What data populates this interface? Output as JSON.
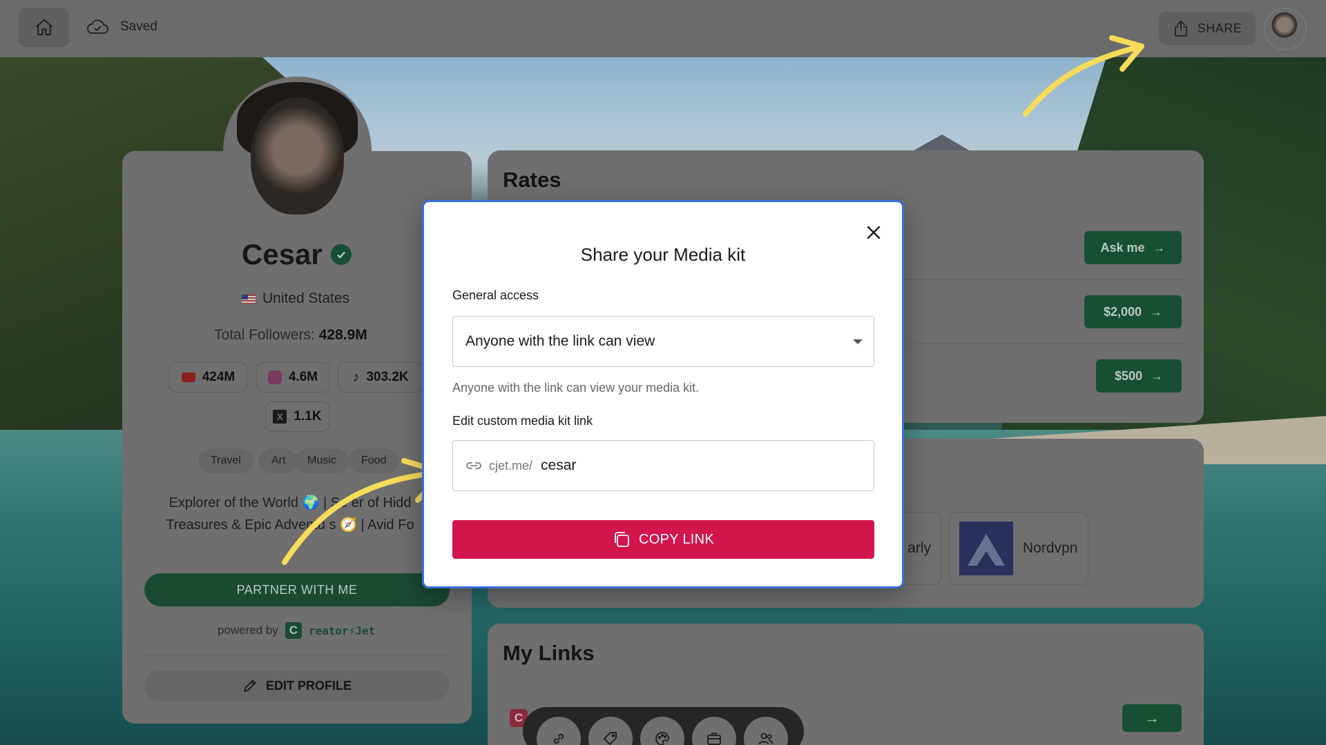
{
  "topbar": {
    "saved_label": "Saved",
    "share_label": "SHARE"
  },
  "profile": {
    "name": "Cesar",
    "country": "United States",
    "followers_label": "Total Followers:",
    "followers_value": "428.9M",
    "socials": [
      {
        "platform": "youtube",
        "count": "424M"
      },
      {
        "platform": "instagram",
        "count": "4.6M"
      },
      {
        "platform": "tiktok",
        "count": "303.2K"
      },
      {
        "platform": "x",
        "count": "1.1K"
      }
    ],
    "tags": [
      "Travel",
      "Art",
      "Music",
      "Food"
    ],
    "bio_line1": "Explorer of the World 🌍 | Se  er of Hidd",
    "bio_line2": "Treasures & Epic Adventu   s 🧭 | Avid Fo",
    "partner_label": "PARTNER WITH ME",
    "powered_by": "powered by",
    "brand_mark": "C",
    "brand_word": "reator⚡Jet",
    "edit_label": "EDIT PROFILE"
  },
  "rates": {
    "title": "Rates",
    "buttons": [
      "Ask me",
      "$2,000",
      "$500"
    ]
  },
  "brands": {
    "partial_text": "arly",
    "nordvpn": "Nordvpn"
  },
  "links": {
    "title": "My Links",
    "badge": "C"
  },
  "modal": {
    "title": "Share your Media kit",
    "access_label": "General access",
    "access_value": "Anyone with the link can view",
    "access_help": "Anyone with the link can view your media kit.",
    "custom_label": "Edit custom media kit link",
    "link_prefix": "cjet.me/",
    "link_value": "cesar",
    "copy_label": "COPY LINK"
  },
  "colors": {
    "accent_red": "#d3154e",
    "brand_green": "#174f35",
    "modal_border": "#3a6fd8",
    "arrow_yellow": "#f7dc5a"
  },
  "icons": {
    "dock": [
      "link-icon",
      "tag-icon",
      "palette-icon",
      "briefcase-icon",
      "users-icon"
    ]
  }
}
